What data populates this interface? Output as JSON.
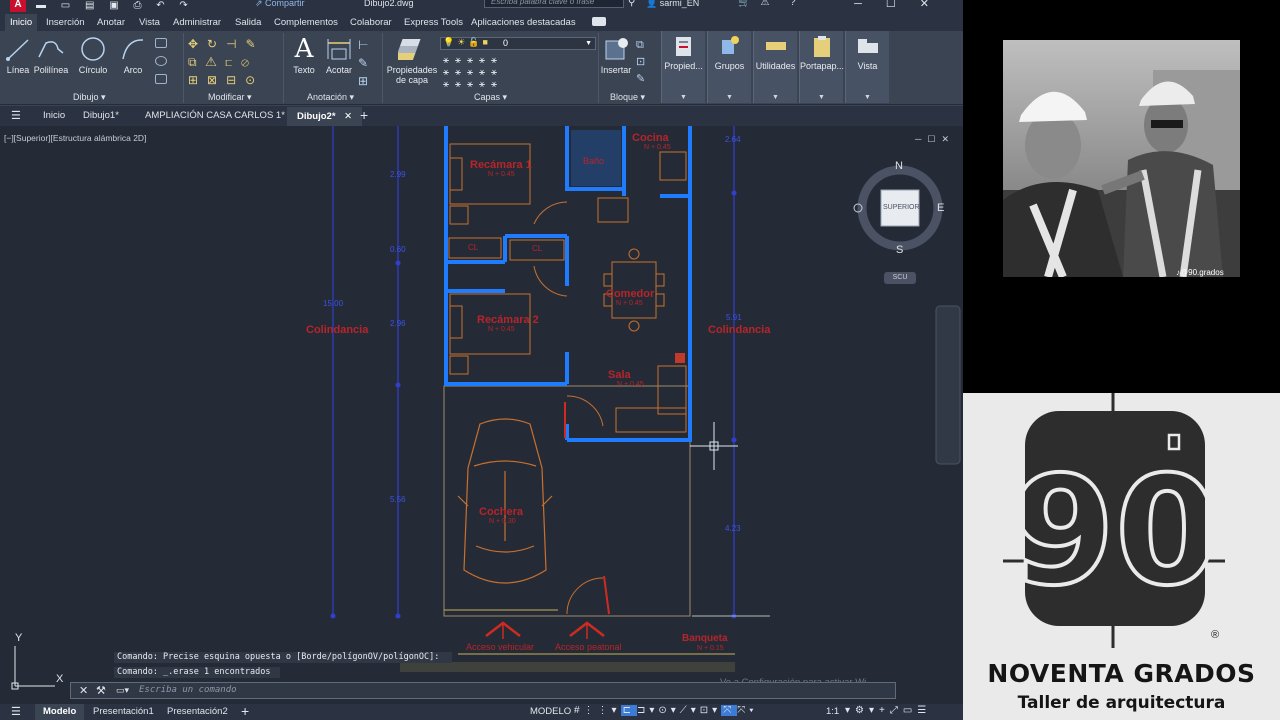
{
  "titlebar": {
    "logo": "A",
    "share": "Compartir",
    "filename": "Dibujo2.dwg",
    "search_placeholder": "Escriba palabra clave o frase",
    "user": "sarmi_EN"
  },
  "ribbon_tabs": [
    "Inicio",
    "Inserción",
    "Anotar",
    "Vista",
    "Administrar",
    "Salida",
    "Complementos",
    "Colaborar",
    "Express Tools",
    "Aplicaciones destacadas"
  ],
  "ribbon": {
    "dibujo_tools": [
      "Línea",
      "Polilínea",
      "Círculo",
      "Arco"
    ],
    "dibujo_title": "Dibujo",
    "modificar_title": "Modificar",
    "texto": "Texto",
    "acotar": "Acotar",
    "anotacion_title": "Anotación",
    "propiedades_capa": [
      "Propiedades",
      "de capa"
    ],
    "layer_value": "0",
    "capas_title": "Capas",
    "insertar": "Insertar",
    "bloque_title": "Bloque",
    "propiedades": "Propied...",
    "grupos": "Grupos",
    "utilidades": "Utilidades",
    "portapapeles": "Portapap...",
    "vista": "Vista"
  },
  "file_tabs": [
    "Inicio",
    "Dibujo1*",
    "AMPLIACIÓN CASA CARLOS 1*",
    "Dibujo2*"
  ],
  "view_label": "[−][Superior][Estructura alámbrica 2D]",
  "viewcube": {
    "north": "N",
    "south": "S",
    "east": "E",
    "label": "SUPERIOR",
    "ucs": "SCU"
  },
  "drawing": {
    "rooms": [
      {
        "name": "Recámara 1",
        "level": "N + 0.45"
      },
      {
        "name": "Baño",
        "level": ""
      },
      {
        "name": "Cocina",
        "level": "N + 0.45"
      },
      {
        "name": "Comedor",
        "level": "N + 0.45"
      },
      {
        "name": "Recámara 2",
        "level": "N + 0.45"
      },
      {
        "name": "Sala",
        "level": "N + 0.45"
      },
      {
        "name": "Cochera",
        "level": "N + 0.30"
      }
    ],
    "closet": "CL",
    "colindancia": "Colindancia",
    "dims_left": [
      "2.99",
      "0.60",
      "2.96",
      "5.56"
    ],
    "dim_total": "15.00",
    "dims_right": [
      "2.64",
      "5.91",
      "4.23"
    ],
    "acceso_vehicular": "Acceso vehicular",
    "acceso_peatonal": "Acceso peatonal",
    "banqueta": "Banqueta",
    "banqueta_level": "N + 0.15",
    "ucs_x": "X",
    "ucs_y": "Y"
  },
  "command": {
    "history": [
      "Comando: Precise esquina opuesta o [Borde/polígonOV/polígonOC]:",
      "Comando: _.erase 1 encontrados"
    ],
    "placeholder": "Escriba un comando",
    "watermark": "Ve a Configuración para activar Wi..."
  },
  "status": {
    "tabs": [
      "Modelo",
      "Presentación1",
      "Presentación2"
    ],
    "model": "MODELO",
    "scale": "1:1"
  },
  "overlay": {
    "handle": "♪@90.grados",
    "brand_logo": "90",
    "brand_name": "NOVENTA GRADOS",
    "brand_sub": "Taller de arquitectura",
    "registered": "®"
  }
}
